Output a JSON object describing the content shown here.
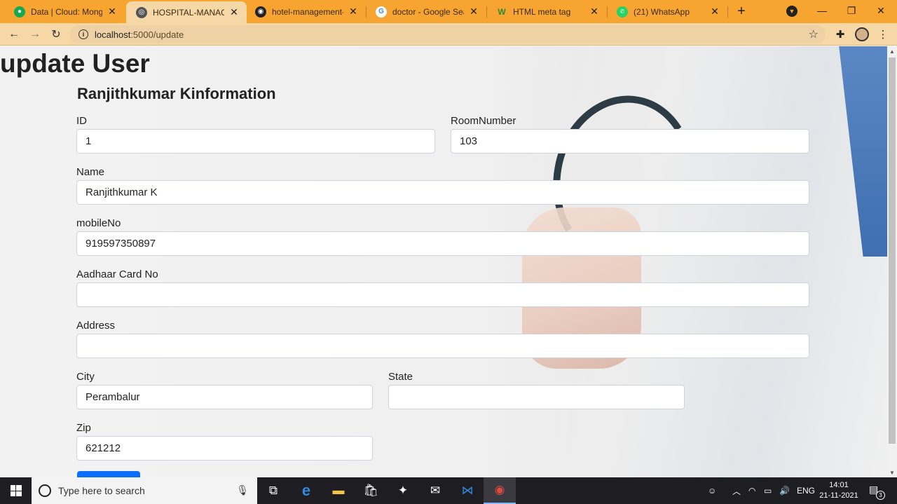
{
  "browser": {
    "tabs": [
      {
        "title": "Data | Cloud: MongoDB",
        "favicon": "mongodb-leaf-icon",
        "active": false
      },
      {
        "title": "HOSPITAL-MANAGEMENT",
        "favicon": "globe-icon",
        "active": true
      },
      {
        "title": "hotel-management-sys",
        "favicon": "github-icon",
        "active": false
      },
      {
        "title": "doctor - Google Search",
        "favicon": "google-icon",
        "active": false
      },
      {
        "title": "HTML meta tag",
        "favicon": "w3schools-icon",
        "active": false
      },
      {
        "title": "(21) WhatsApp",
        "favicon": "whatsapp-icon",
        "active": false
      }
    ],
    "url_host": "localhost",
    "url_path": ":5000/update",
    "tab_color": "#f7a430",
    "toolbar_color": "#f6d7a6"
  },
  "page": {
    "title": "update User",
    "heading": "Ranjithkumar Kinformation",
    "fields": {
      "id": {
        "label": "ID",
        "value": "1"
      },
      "room": {
        "label": "RoomNumber",
        "value": "103"
      },
      "name": {
        "label": "Name",
        "value": "Ranjithkumar K"
      },
      "mobile": {
        "label": "mobileNo",
        "value": "919597350897"
      },
      "aadhaar": {
        "label": "Aadhaar Card No",
        "value": ""
      },
      "address": {
        "label": "Address",
        "value": ""
      },
      "city": {
        "label": "City",
        "value": "Perambalur"
      },
      "state": {
        "label": "State",
        "value": ""
      },
      "zip": {
        "label": "Zip",
        "value": "621212"
      }
    },
    "button_color": "#0d6efd"
  },
  "taskbar": {
    "search_placeholder": "Type here to search",
    "language": "ENG",
    "time": "14:01",
    "date": "21-11-2021",
    "notification_count": "3"
  }
}
